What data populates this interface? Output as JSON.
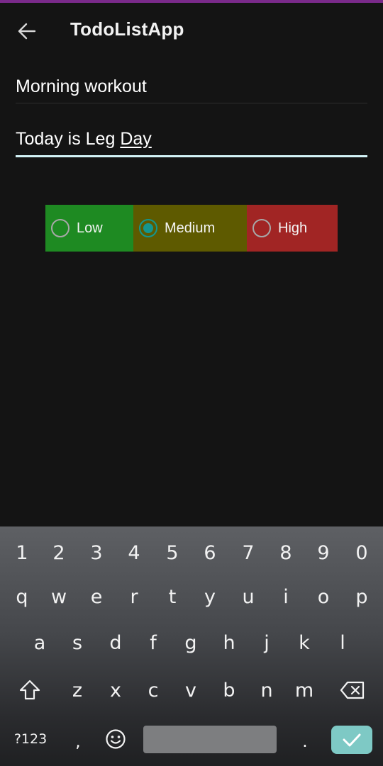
{
  "colors": {
    "status_accent": "#7a2a8a",
    "background": "#141414",
    "priority_low_bg": "#1e8a22",
    "priority_medium_bg": "#5e5a00",
    "priority_high_bg": "#a12524",
    "radio_checked": "#14968f",
    "active_underline": "#d3f3f7",
    "enter_key": "#7ec9c5"
  },
  "app_bar": {
    "title": "TodoListApp",
    "back_icon": "arrow-left-icon"
  },
  "form": {
    "title_value": "Morning workout",
    "description_value_prefix": "Today is Leg ",
    "description_value_underlined": "Day"
  },
  "priority": {
    "selected": "Medium",
    "options": [
      {
        "label": "Low"
      },
      {
        "label": "Medium"
      },
      {
        "label": "High"
      }
    ]
  },
  "keyboard": {
    "number_row": [
      "1",
      "2",
      "3",
      "4",
      "5",
      "6",
      "7",
      "8",
      "9",
      "0"
    ],
    "row1": [
      "q",
      "w",
      "e",
      "r",
      "t",
      "y",
      "u",
      "i",
      "o",
      "p"
    ],
    "row2": [
      "a",
      "s",
      "d",
      "f",
      "g",
      "h",
      "j",
      "k",
      "l"
    ],
    "row3": [
      "z",
      "x",
      "c",
      "v",
      "b",
      "n",
      "m"
    ],
    "symbols_label": "?123",
    "comma_label": ",",
    "period_label": ".",
    "shift_icon": "shift-icon",
    "backspace_icon": "backspace-icon",
    "emoji_icon": "emoji-icon",
    "enter_icon": "check-icon"
  }
}
